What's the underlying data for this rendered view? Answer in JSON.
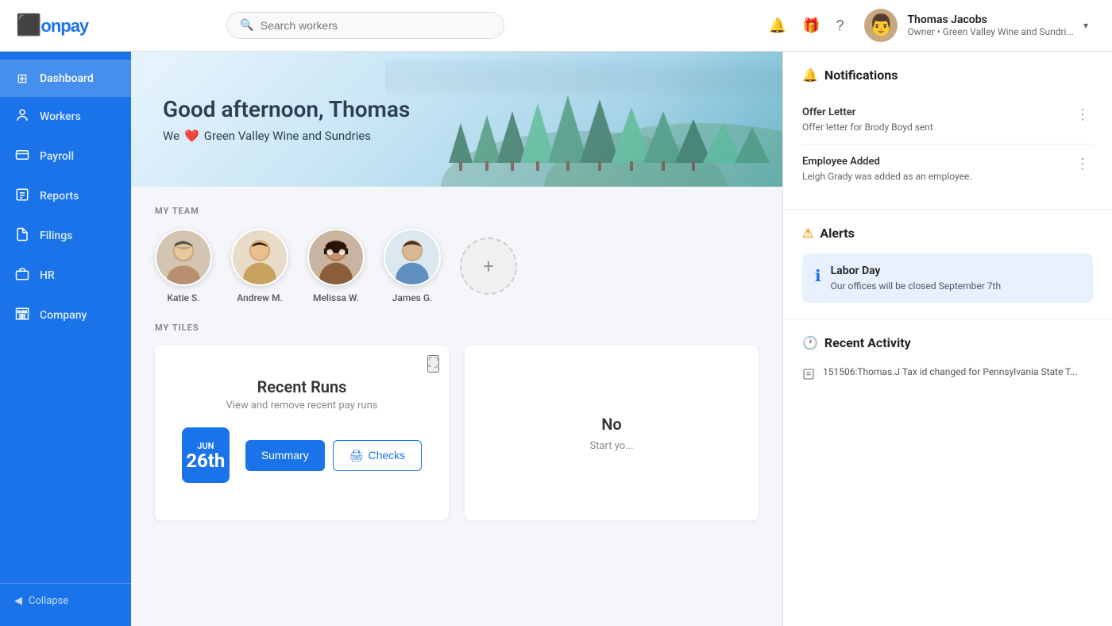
{
  "header": {
    "logo_text": "onpay",
    "search_placeholder": "Search workers",
    "user_name": "Thomas Jacobs",
    "user_role": "Owner • Green Valley Wine and Sundri...",
    "chevron": "▾"
  },
  "sidebar": {
    "items": [
      {
        "id": "dashboard",
        "label": "Dashboard",
        "icon": "⊞",
        "active": true
      },
      {
        "id": "workers",
        "label": "Workers",
        "icon": "👤",
        "active": false
      },
      {
        "id": "payroll",
        "label": "Payroll",
        "icon": "💳",
        "active": false
      },
      {
        "id": "reports",
        "label": "Reports",
        "icon": "📋",
        "active": false
      },
      {
        "id": "filings",
        "label": "Filings",
        "icon": "🗂",
        "active": false
      },
      {
        "id": "hr",
        "label": "HR",
        "icon": "🏢",
        "active": false
      },
      {
        "id": "company",
        "label": "Company",
        "icon": "🏬",
        "active": false
      }
    ],
    "collapse_label": "Collapse"
  },
  "banner": {
    "greeting": "Good afternoon, Thomas",
    "sub_text": "We",
    "heart": "❤️",
    "company": "Green Valley Wine and Sundries"
  },
  "my_team": {
    "section_title": "MY TEAM",
    "members": [
      {
        "name": "Katie S.",
        "emoji": "👩"
      },
      {
        "name": "Andrew M.",
        "emoji": "👨"
      },
      {
        "name": "Melissa W.",
        "emoji": "👩"
      },
      {
        "name": "James G.",
        "emoji": "👨"
      }
    ],
    "add_label": "+"
  },
  "my_tiles": {
    "section_title": "MY TILES",
    "recent_runs": {
      "title": "Recent Runs",
      "subtitle": "View and remove recent pay runs",
      "run_month": "Jun",
      "run_day": "26th",
      "summary_label": "Summary",
      "checks_label": "Checks"
    },
    "tile2_partial": "No"
  },
  "notifications": {
    "section_title": "Notifications",
    "bell_icon": "🔔",
    "items": [
      {
        "title": "Offer Letter",
        "desc": "Offer letter for Brody Boyd sent"
      },
      {
        "title": "Employee Added",
        "desc": "Leigh Grady was added as an employee."
      }
    ],
    "alerts_title": "Alerts",
    "alert_icon": "⚠",
    "alerts": [
      {
        "icon": "ℹ",
        "title": "Labor Day",
        "desc": "Our offices will be closed September 7th"
      }
    ],
    "recent_activity_title": "Recent Activity",
    "recent_icon": "🕐",
    "activities": [
      {
        "text": "151506:Thomas.J Tax id changed for Pennsylvania State T..."
      }
    ]
  }
}
